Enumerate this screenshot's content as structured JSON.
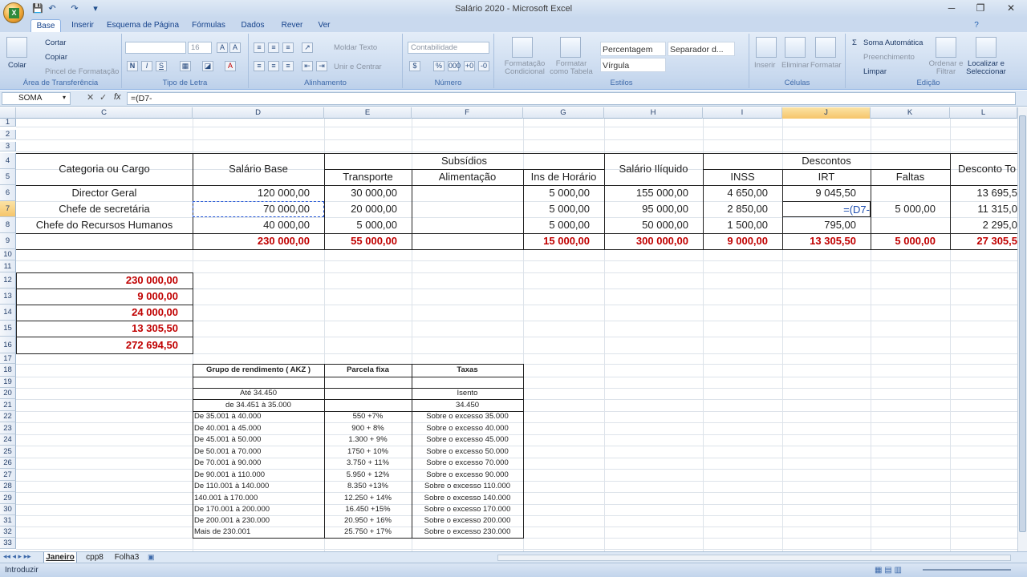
{
  "window": {
    "title": "Salário 2020 - Microsoft Excel",
    "minimize": "─",
    "restore": "❐",
    "close": "✕",
    "qa_save": "💾",
    "qa_undo": "↶",
    "qa_redo": "↷",
    "qa_more": "▾"
  },
  "ribbon_tabs": [
    "Base",
    "Inserir",
    "Esquema de Página",
    "Fórmulas",
    "Dados",
    "Rever",
    "Ver"
  ],
  "ribbon": {
    "clipboard": {
      "paste": "Colar",
      "cut": "Cortar",
      "copy": "Copiar",
      "format_painter": "Pincel de Formatação",
      "label": "Área de Transferência"
    },
    "font": {
      "font_size": "16",
      "bold": "N",
      "italic": "I",
      "underline": "S",
      "label": "Tipo de Letra"
    },
    "alignment": {
      "wrap": "Moldar Texto",
      "merge": "Unir e Centrar",
      "label": "Alinhamento"
    },
    "number": {
      "format": "Contabilidade",
      "label": "Número"
    },
    "styles": {
      "cond_format": "Formatação Condicional",
      "format_table": "Formatar como Tabela",
      "percent": "Percentagem",
      "separator": "Separador d...",
      "comma": "Vírgula",
      "label": "Estilos"
    },
    "cells": {
      "insert": "Inserir",
      "delete": "Eliminar",
      "format": "Formatar",
      "label": "Células"
    },
    "editing": {
      "autosum": "Soma Automática",
      "fill": "Preenchimento",
      "clear": "Limpar",
      "sort": "Ordenar e Filtrar",
      "find": "Localizar e Seleccionar",
      "label": "Edição"
    }
  },
  "formula_bar": {
    "name_box": "SOMA",
    "fx": "fx",
    "content": "=(D7-"
  },
  "columns": [
    "C",
    "D",
    "E",
    "F",
    "G",
    "H",
    "I",
    "J",
    "K",
    "L"
  ],
  "rows": [
    "1",
    "2",
    "3",
    "4",
    "5",
    "6",
    "7",
    "8",
    "9",
    "10",
    "11",
    "12",
    "13",
    "14",
    "15",
    "16",
    "17",
    "18",
    "19",
    "20",
    "21",
    "22",
    "23",
    "24",
    "25",
    "26",
    "27",
    "28",
    "29",
    "30",
    "31",
    "32",
    "33"
  ],
  "main_table": {
    "header_categoria": "Categoria ou Cargo",
    "header_salario_base": "Salário Base",
    "header_subsidios": "Subsídios",
    "header_transporte": "Transporte",
    "header_alimentacao": "Alimentação",
    "header_ins_horario": "Ins de Horário",
    "header_salario_liquido": "Salário Ilíquido",
    "header_descontos": "Descontos",
    "header_inss": "INSS",
    "header_irt": "IRT",
    "header_faltas": "Faltas",
    "header_desconto_total": "Desconto To",
    "rows": [
      {
        "cargo": "Director Geral",
        "base": "120 000,00",
        "transporte": "30 000,00",
        "alimentacao": "",
        "ins": "5 000,00",
        "iliquido": "155 000,00",
        "inss": "4 650,00",
        "irt": "9 045,50",
        "faltas": "",
        "total": "13 695,5"
      },
      {
        "cargo": "Chefe de secretária",
        "base": "70 000,00",
        "transporte": "20 000,00",
        "alimentacao": "",
        "ins": "5 000,00",
        "iliquido": "95 000,00",
        "inss": "2 850,00",
        "irt": "=(D7-",
        "faltas": "5 000,00",
        "total": "11 315,0"
      },
      {
        "cargo": "Chefe do Recursos Humanos",
        "base": "40 000,00",
        "transporte": "5 000,00",
        "alimentacao": "",
        "ins": "5 000,00",
        "iliquido": "50 000,00",
        "inss": "1 500,00",
        "irt": "795,00",
        "faltas": "",
        "total": "2 295,0"
      }
    ],
    "totals": {
      "base": "230 000,00",
      "transporte": "55 000,00",
      "ins": "15 000,00",
      "iliquido": "300 000,00",
      "inss": "9 000,00",
      "irt": "13 305,50",
      "faltas": "5 000,00",
      "total": "27 305,5"
    }
  },
  "side_totals": [
    "230 000,00",
    "9 000,00",
    "24 000,00",
    "13 305,50",
    "272 694,50"
  ],
  "tax_table": {
    "header_grupo": "Grupo de rendimento ( AKZ )",
    "header_parcela": "Parcela fixa",
    "header_taxas": "Taxas",
    "rows": [
      {
        "grupo": "Até 34.450",
        "parcela": "",
        "taxa": "Isento"
      },
      {
        "grupo": "de 34.451 à 35.000",
        "parcela": "",
        "taxa": "34.450"
      },
      {
        "grupo": "De 35.001 à 40.000",
        "parcela": "550 +7%",
        "taxa": "Sobre o excesso 35.000"
      },
      {
        "grupo": "De 40.001 à 45.000",
        "parcela": "900 + 8%",
        "taxa": "Sobre o excesso 40.000"
      },
      {
        "grupo": "De 45.001 à 50.000",
        "parcela": "1.300 + 9%",
        "taxa": "Sobre o excesso 45.000"
      },
      {
        "grupo": "De 50.001 à 70.000",
        "parcela": "1750 + 10%",
        "taxa": "Sobre o excesso 50.000"
      },
      {
        "grupo": "De 70.001 à 90.000",
        "parcela": "3.750 + 11%",
        "taxa": "Sobre o excesso 70.000"
      },
      {
        "grupo": "De 90.001 à 110.000",
        "parcela": "5.950 + 12%",
        "taxa": "Sobre o excesso 90.000"
      },
      {
        "grupo": "De 110.001 à 140.000",
        "parcela": "8.350 +13%",
        "taxa": "Sobre o excesso 110.000"
      },
      {
        "grupo": "140.001 à 170.000",
        "parcela": "12.250 + 14%",
        "taxa": "Sobre o excesso 140.000"
      },
      {
        "grupo": "De 170.001 à 200.000",
        "parcela": "16.450 +15%",
        "taxa": "Sobre o excesso 170.000"
      },
      {
        "grupo": "De 200.001 à 230.000",
        "parcela": "20.950 + 16%",
        "taxa": "Sobre o excesso 200.000"
      },
      {
        "grupo": "Mais de 230.001",
        "parcela": "25.750 + 17%",
        "taxa": "Sobre o excesso 230.000"
      }
    ]
  },
  "sheet_tabs": [
    "Janeiro",
    "cpp8",
    "Folha3"
  ],
  "status": {
    "mode": "Introduzir"
  }
}
